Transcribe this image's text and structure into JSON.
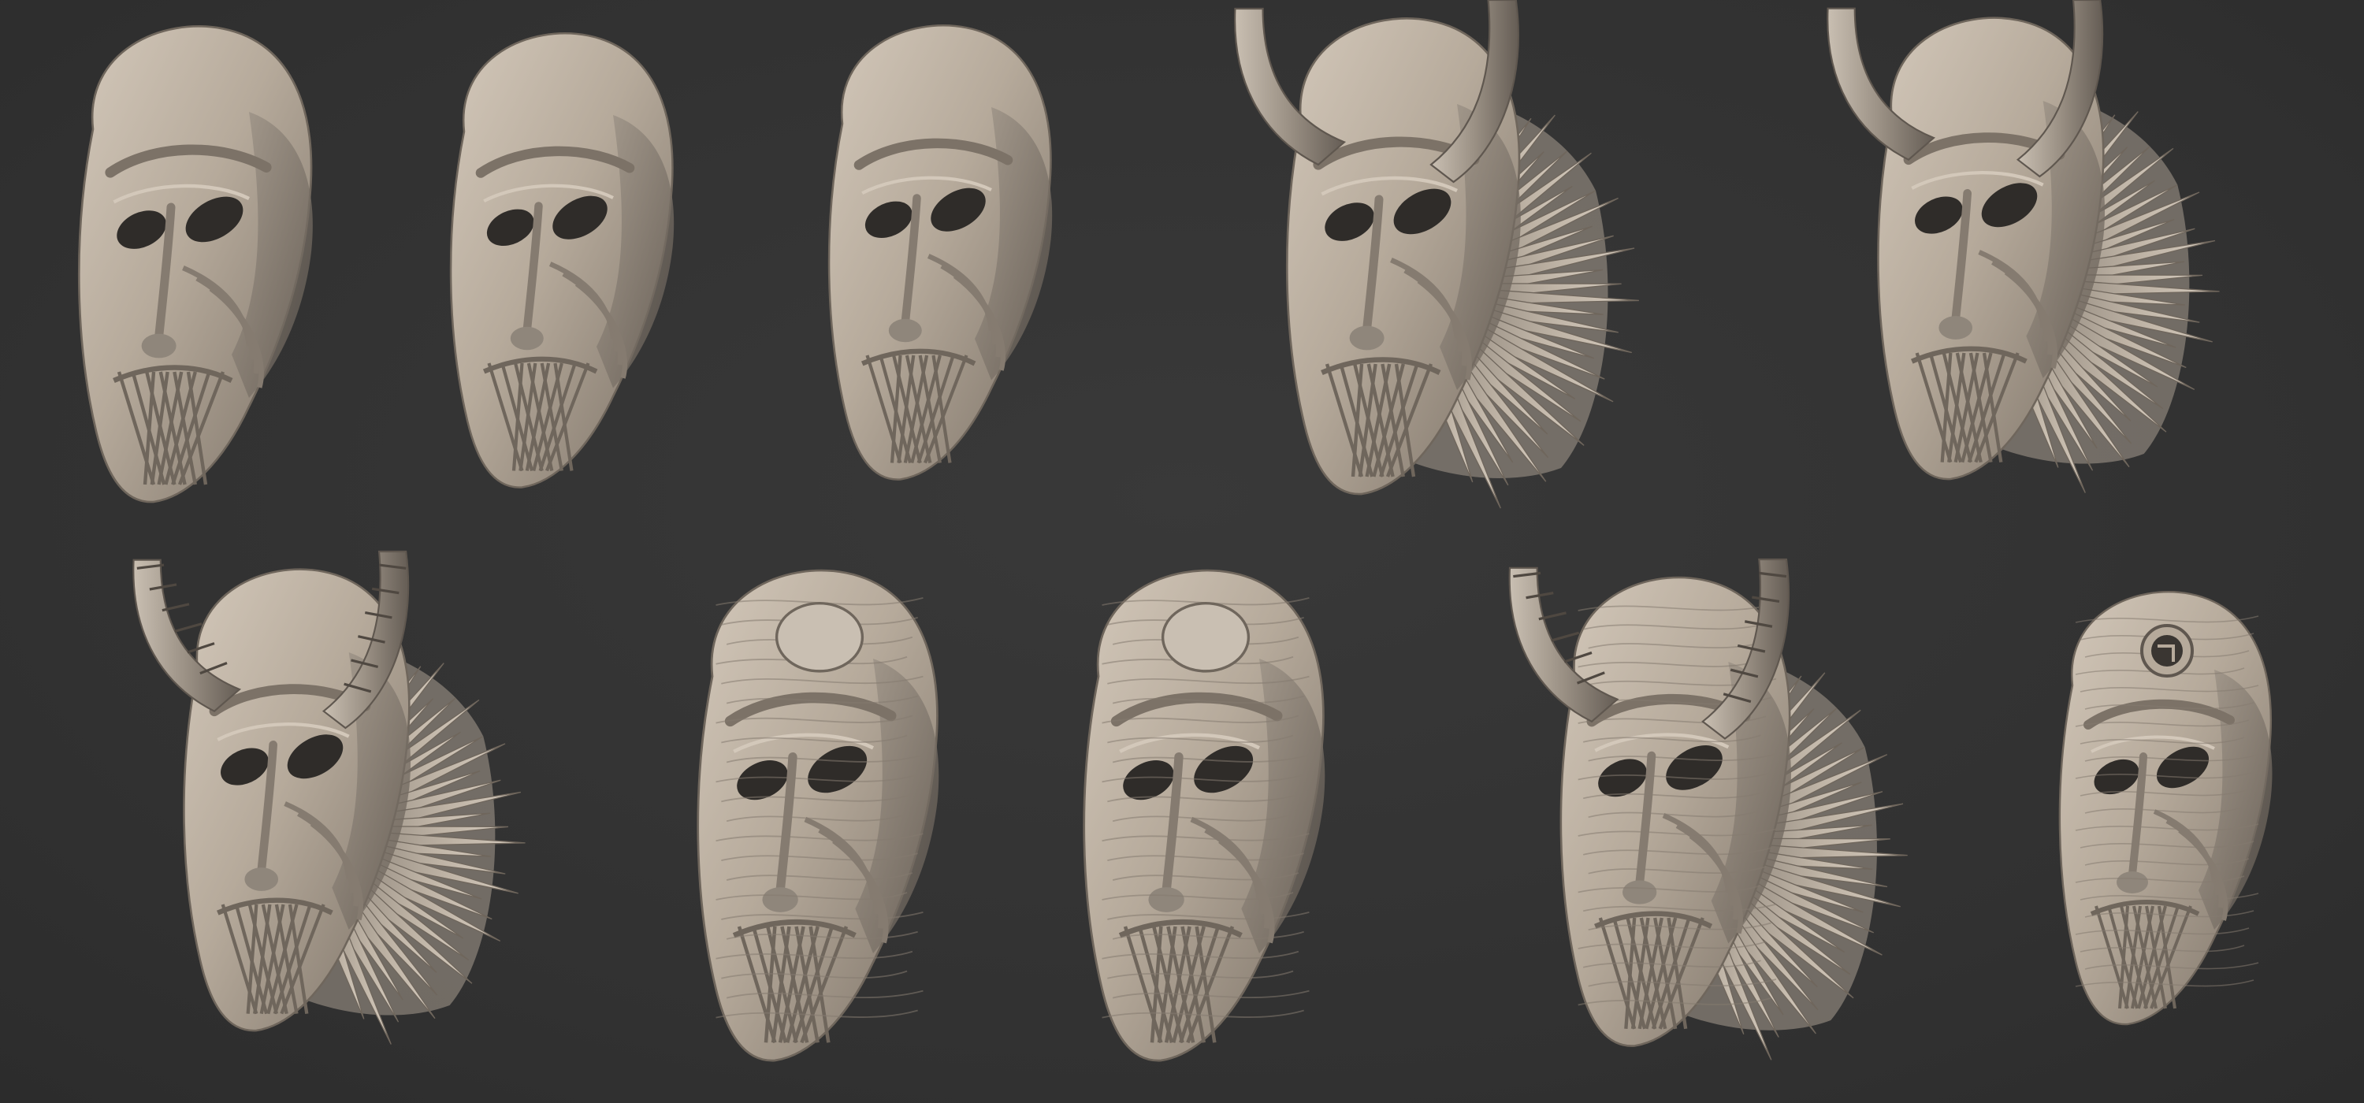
{
  "sheet": {
    "background_color": "#333333",
    "clay_color": "#b6aa9b",
    "clay_shadow_color": "#6f665c",
    "clay_highlight_color": "#d3c8ba"
  },
  "masks": [
    {
      "row": 1,
      "index": 1,
      "stage": "base-sculpt",
      "horns": "none",
      "mane": false,
      "forehead_disc": "none"
    },
    {
      "row": 1,
      "index": 2,
      "stage": "base-sculpt",
      "horns": "none",
      "mane": false,
      "forehead_disc": "none"
    },
    {
      "row": 1,
      "index": 3,
      "stage": "refined-sculpt",
      "horns": "none",
      "mane": false,
      "forehead_disc": "none"
    },
    {
      "row": 1,
      "index": 4,
      "stage": "full",
      "horns": "smooth",
      "mane": true,
      "forehead_disc": "none"
    },
    {
      "row": 1,
      "index": 5,
      "stage": "full",
      "horns": "smooth",
      "mane": true,
      "forehead_disc": "none"
    },
    {
      "row": 2,
      "index": 1,
      "stage": "full",
      "horns": "segmented",
      "mane": true,
      "forehead_disc": "none"
    },
    {
      "row": 2,
      "index": 2,
      "stage": "textured",
      "horns": "none",
      "mane": false,
      "forehead_disc": "solid"
    },
    {
      "row": 2,
      "index": 3,
      "stage": "textured",
      "horns": "none",
      "mane": false,
      "forehead_disc": "solid"
    },
    {
      "row": 2,
      "index": 4,
      "stage": "full-textured",
      "horns": "segmented",
      "mane": true,
      "forehead_disc": "none"
    },
    {
      "row": 2,
      "index": 5,
      "stage": "textured",
      "horns": "none",
      "mane": false,
      "forehead_disc": "socket"
    }
  ]
}
